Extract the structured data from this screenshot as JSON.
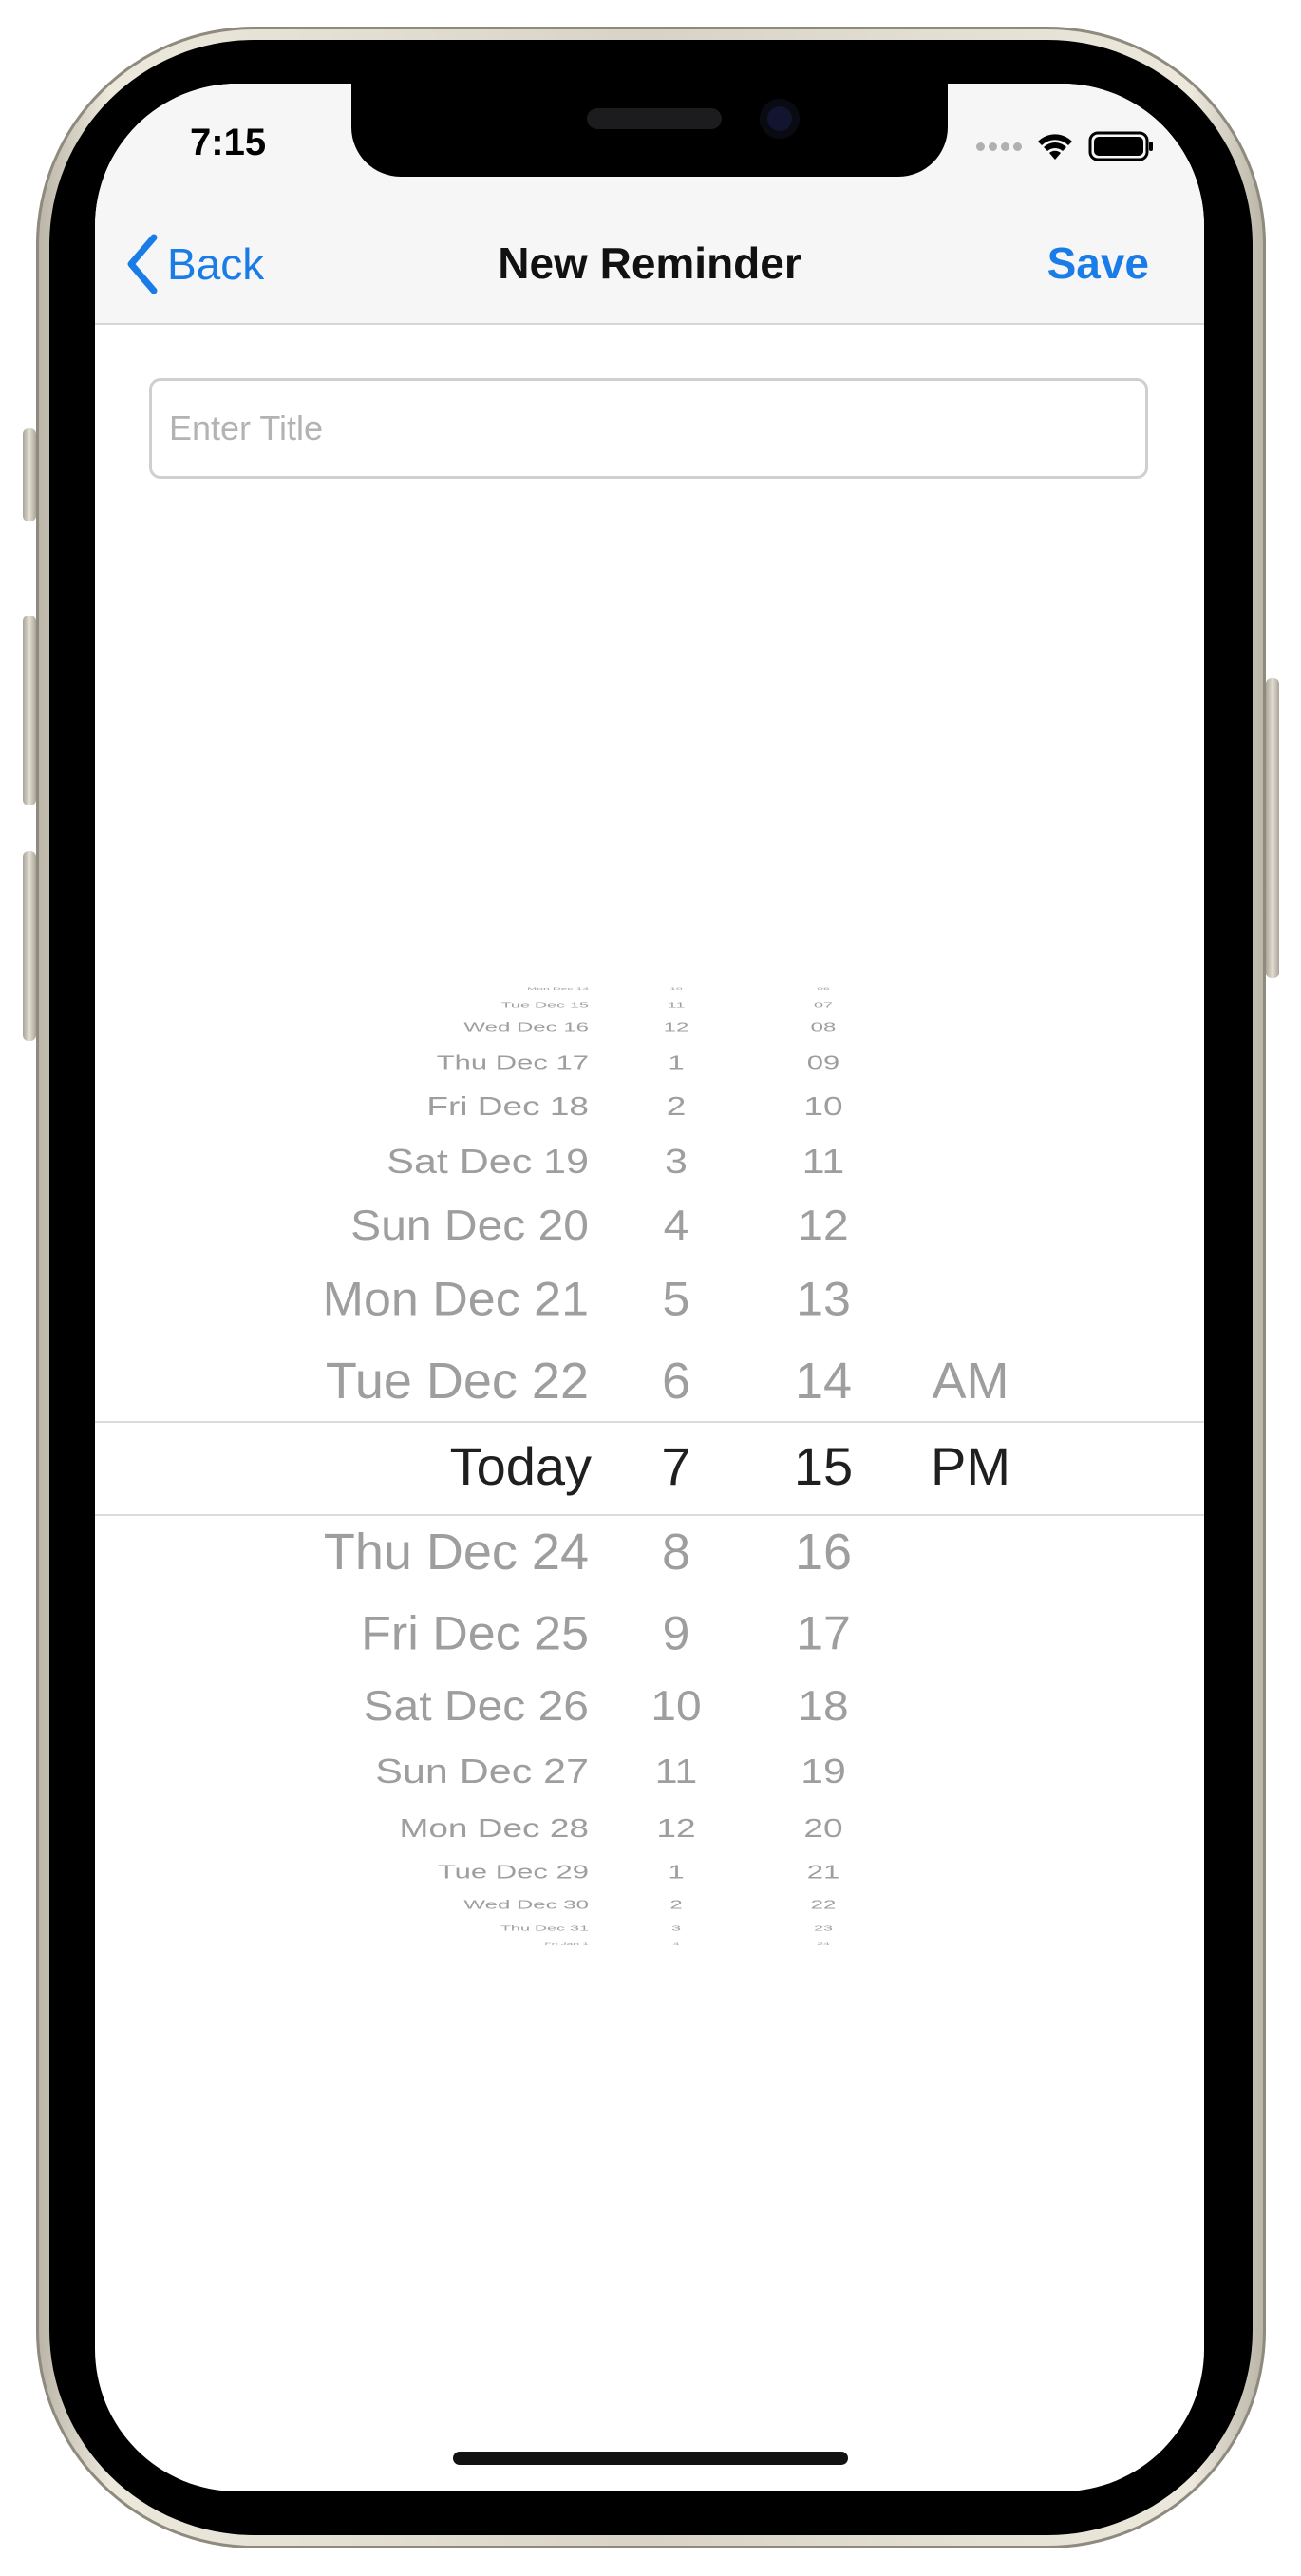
{
  "status_bar": {
    "time": "7:15",
    "signal_icon": "cellular-signal-icon",
    "wifi_icon": "wifi-icon",
    "battery_icon": "battery-icon"
  },
  "nav": {
    "back_label": "Back",
    "title": "New Reminder",
    "save_label": "Save",
    "accent_color": "#1a7ce6"
  },
  "form": {
    "title_placeholder": "Enter Title",
    "title_value": ""
  },
  "date_picker": {
    "selected": {
      "date": "Today",
      "hour": "7",
      "minute": "15",
      "period": "PM"
    },
    "dates_above": [
      "Mon Dec 14",
      "Tue Dec 15",
      "Wed Dec 16",
      "Thu Dec 17",
      "Fri Dec 18",
      "Sat Dec 19",
      "Sun Dec 20",
      "Mon Dec 21",
      "Tue Dec 22"
    ],
    "dates_below": [
      "Thu Dec 24",
      "Fri Dec 25",
      "Sat Dec 26",
      "Sun Dec 27",
      "Mon Dec 28",
      "Tue Dec 29",
      "Wed Dec 30",
      "Thu Dec 31",
      "Fri Jan 1"
    ],
    "hours_above": [
      "10",
      "11",
      "12",
      "1",
      "2",
      "3",
      "4",
      "5",
      "6"
    ],
    "hours_below": [
      "8",
      "9",
      "10",
      "11",
      "12",
      "1",
      "2",
      "3",
      "4"
    ],
    "minutes_above": [
      "06",
      "07",
      "08",
      "09",
      "10",
      "11",
      "12",
      "13",
      "14"
    ],
    "minutes_below": [
      "16",
      "17",
      "18",
      "19",
      "20",
      "21",
      "22",
      "23",
      "24"
    ],
    "period_above": [
      "AM"
    ],
    "period_below": []
  }
}
